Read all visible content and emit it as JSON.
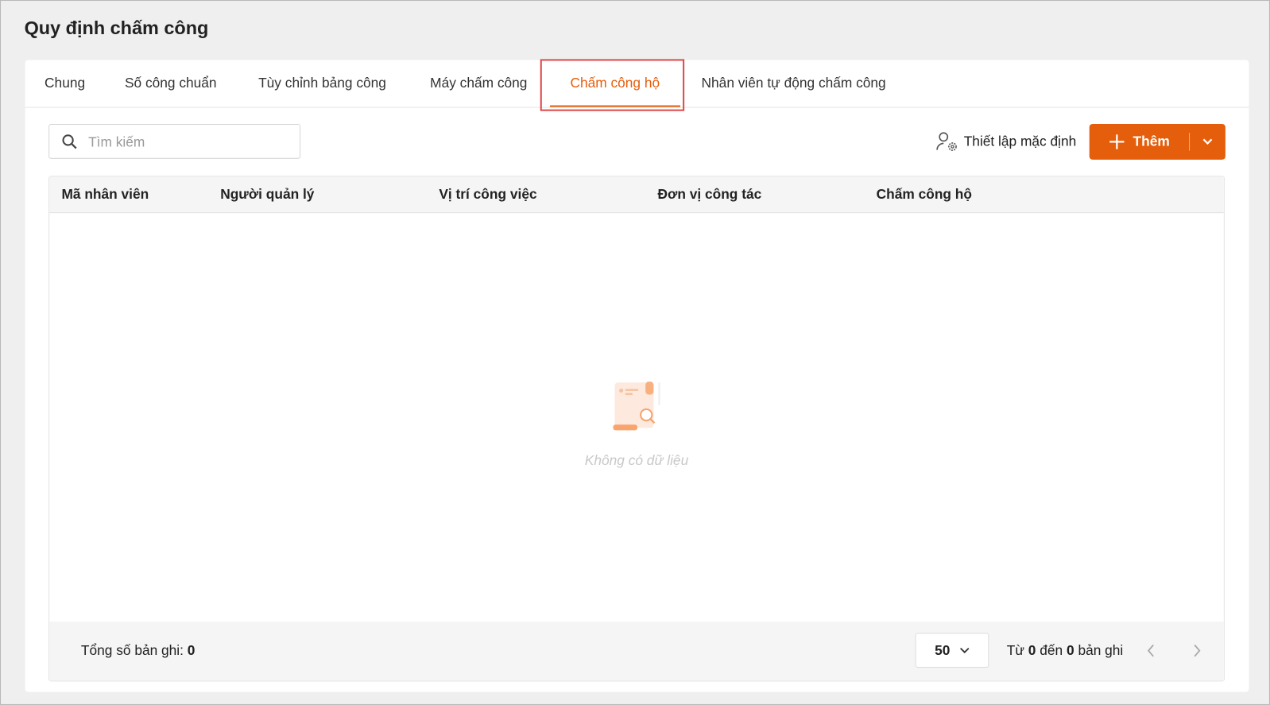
{
  "page_title": "Quy định chấm công",
  "tabs": [
    {
      "label": "Chung"
    },
    {
      "label": "Số công chuẩn"
    },
    {
      "label": "Tùy chỉnh bảng công"
    },
    {
      "label": "Máy chấm công"
    },
    {
      "label": "Chấm công hộ",
      "active": true
    },
    {
      "label": "Nhân viên tự động chấm công"
    }
  ],
  "search": {
    "placeholder": "Tìm kiếm",
    "value": ""
  },
  "toolbar": {
    "set_default_label": "Thiết lập mặc định",
    "add_label": "Thêm"
  },
  "table": {
    "columns": [
      "Mã nhân viên",
      "Người quản lý",
      "Vị trí công việc",
      "Đơn vị công tác",
      "Chấm công hộ"
    ],
    "rows": [],
    "empty_text": "Không có dữ liệu"
  },
  "footer": {
    "total_label": "Tổng số bản ghi:",
    "total": "0",
    "page_size": "50",
    "range_from_label": "Từ",
    "range_from": "0",
    "range_to_label": "đến",
    "range_to": "0",
    "range_suffix": "bản ghi"
  },
  "colors": {
    "accent": "#e55e0b",
    "highlight": "#e04848"
  }
}
